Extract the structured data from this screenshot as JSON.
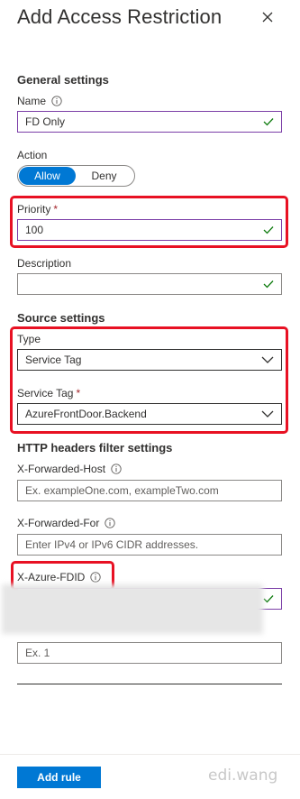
{
  "panel": {
    "title": "Add Access Restriction"
  },
  "general": {
    "heading": "General settings",
    "name_label": "Name",
    "name_value": "FD Only",
    "action_label": "Action",
    "action_options": [
      "Allow",
      "Deny"
    ],
    "action_selected": "Allow",
    "priority_label": "Priority",
    "priority_value": "100",
    "description_label": "Description",
    "description_value": ""
  },
  "source": {
    "heading": "Source settings",
    "type_label": "Type",
    "type_value": "Service Tag",
    "service_tag_label": "Service Tag",
    "service_tag_value": "AzureFrontDoor.Backend"
  },
  "http_headers": {
    "heading": "HTTP headers filter settings",
    "forwarded_host_label": "X-Forwarded-Host",
    "forwarded_host_placeholder": "Ex. exampleOne.com, exampleTwo.com",
    "forwarded_for_label": "X-Forwarded-For",
    "forwarded_for_placeholder": "Enter IPv4 or IPv6 CIDR addresses.",
    "fdid_label": "X-Azure-FDID",
    "health_probe_placeholder": "Ex. 1"
  },
  "footer": {
    "add_rule_label": "Add rule",
    "watermark": "edi.wang"
  },
  "colors": {
    "accent": "#0078d4",
    "valid_border": "#7b3ea7",
    "check": "#107c10",
    "highlight": "#e81123",
    "required": "#a4262c"
  }
}
